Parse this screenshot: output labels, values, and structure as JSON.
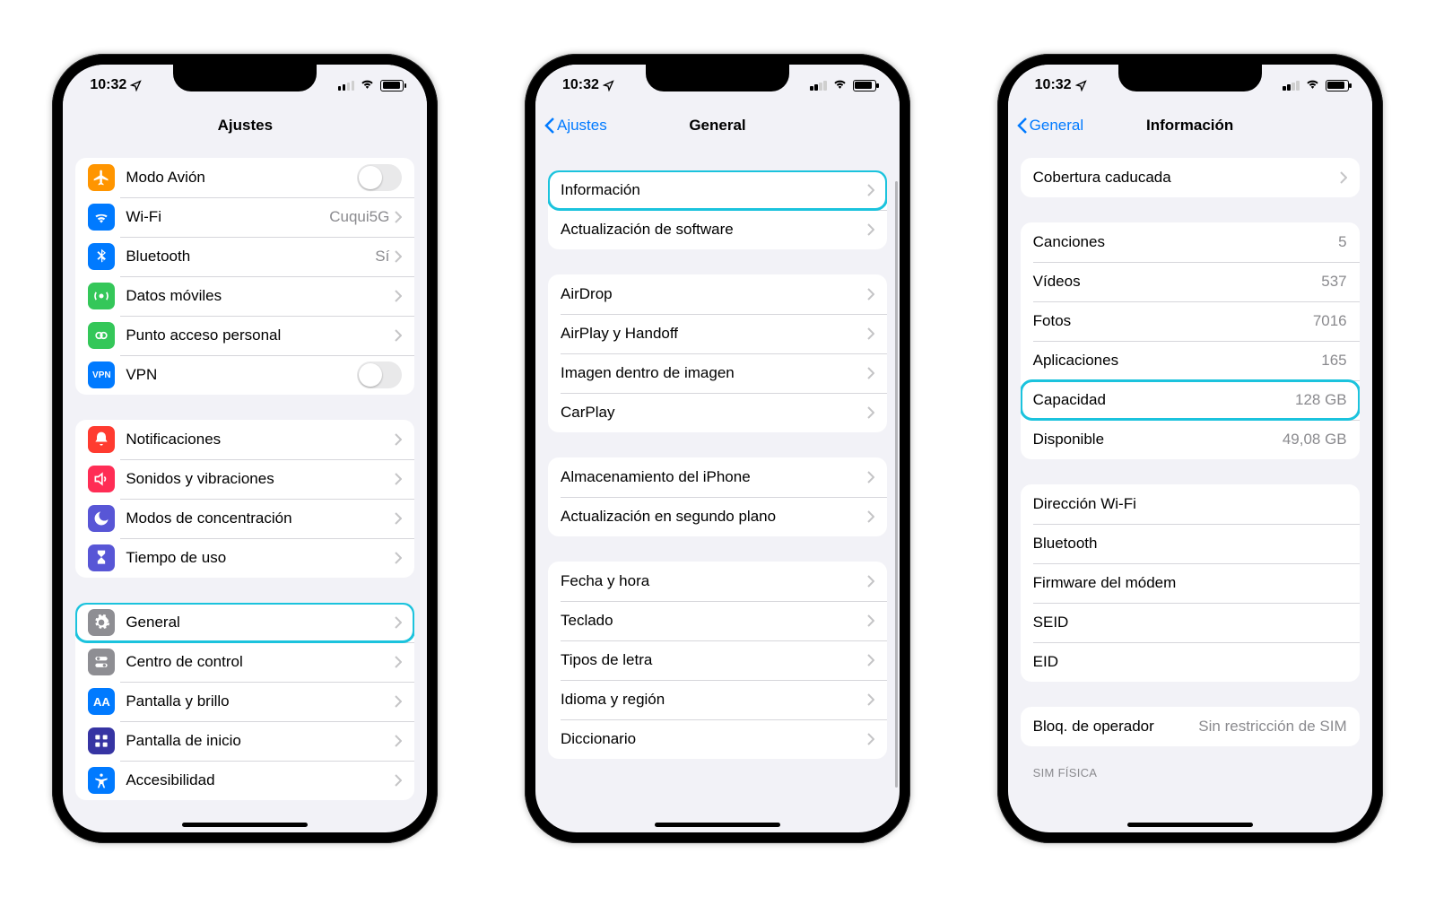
{
  "status": {
    "time": "10:32"
  },
  "phone1": {
    "title": "Ajustes",
    "items": {
      "airplane": "Modo Avión",
      "wifi": "Wi-Fi",
      "wifi_value": "Cuqui5G",
      "bluetooth": "Bluetooth",
      "bluetooth_value": "Sí",
      "cellular": "Datos móviles",
      "hotspot": "Punto acceso personal",
      "vpn": "VPN",
      "notifications": "Notificaciones",
      "sounds": "Sonidos y vibraciones",
      "focus": "Modos de concentración",
      "screentime": "Tiempo de uso",
      "general": "General",
      "control_center": "Centro de control",
      "display": "Pantalla y brillo",
      "home": "Pantalla de inicio",
      "accessibility": "Accesibilidad"
    }
  },
  "phone2": {
    "back": "Ajustes",
    "title": "General",
    "items": {
      "about": "Información",
      "update": "Actualización de software",
      "airdrop": "AirDrop",
      "airplay": "AirPlay y Handoff",
      "pip": "Imagen dentro de imagen",
      "carplay": "CarPlay",
      "storage": "Almacenamiento del iPhone",
      "background": "Actualización en segundo plano",
      "datetime": "Fecha y hora",
      "keyboard": "Teclado",
      "fonts": "Tipos de letra",
      "language": "Idioma y región",
      "dictionary": "Diccionario"
    }
  },
  "phone3": {
    "back": "General",
    "title": "Información",
    "items": {
      "coverage": "Cobertura caducada",
      "songs": "Canciones",
      "songs_v": "5",
      "videos": "Vídeos",
      "videos_v": "537",
      "photos": "Fotos",
      "photos_v": "7016",
      "apps": "Aplicaciones",
      "apps_v": "165",
      "capacity": "Capacidad",
      "capacity_v": "128 GB",
      "available": "Disponible",
      "available_v": "49,08 GB",
      "wifi_addr": "Dirección Wi-Fi",
      "bt_addr": "Bluetooth",
      "modem": "Firmware del módem",
      "seid": "SEID",
      "eid": "EID",
      "carrier_lock": "Bloq. de operador",
      "carrier_lock_v": "Sin restricción de SIM",
      "sim_header": "SIM FÍSICA"
    }
  }
}
